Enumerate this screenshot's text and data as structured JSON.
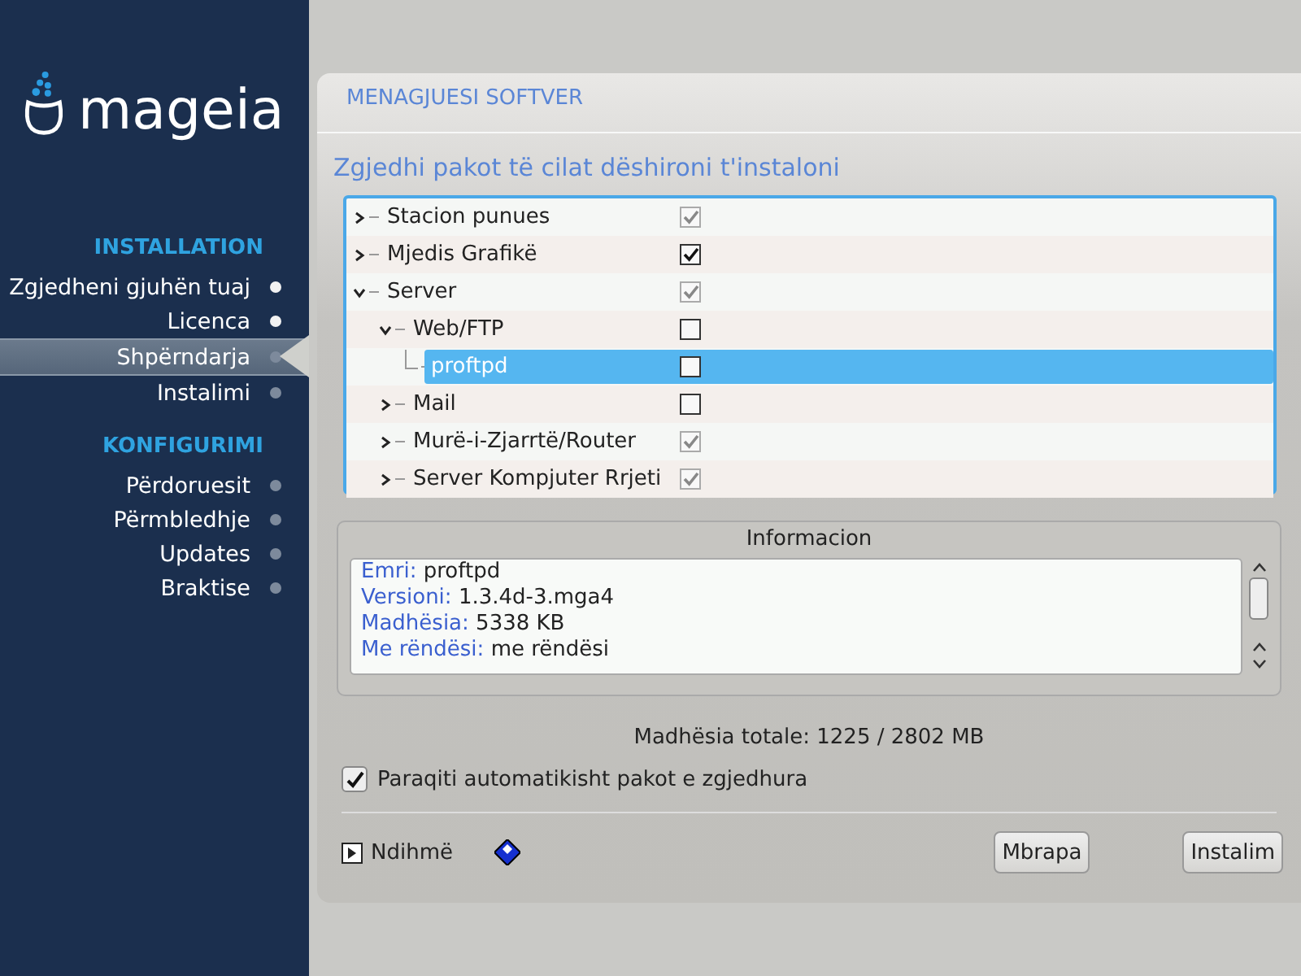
{
  "sidebar": {
    "logo": "mageia",
    "sections": [
      {
        "title": "INSTALLATION",
        "items": [
          {
            "label": "Zgjedheni gjuhën tuaj",
            "done": true,
            "selected": false
          },
          {
            "label": "Licenca",
            "done": true,
            "selected": false
          },
          {
            "label": "Shpërndarja",
            "done": false,
            "selected": true
          },
          {
            "label": "Instalimi",
            "done": false,
            "selected": false
          }
        ]
      },
      {
        "title": "KONFIGURIMI",
        "items": [
          {
            "label": "Përdoruesit",
            "done": false,
            "selected": false
          },
          {
            "label": "Përmbledhje",
            "done": false,
            "selected": false
          },
          {
            "label": "Updates",
            "done": false,
            "selected": false
          },
          {
            "label": "Braktise",
            "done": false,
            "selected": false
          }
        ]
      }
    ]
  },
  "panel": {
    "title": "MENAGJUESI SOFTVER",
    "subtitle": "Zgjedhi pakot të cilat dëshironi t'instaloni",
    "tree": [
      {
        "label": "Stacion punues",
        "checked": true,
        "dimmed": true,
        "expanded": false,
        "selected": false
      },
      {
        "label": "Mjedis Grafikë",
        "checked": true,
        "dimmed": false,
        "expanded": false,
        "selected": false
      },
      {
        "label": "Server",
        "checked": true,
        "dimmed": true,
        "expanded": true,
        "selected": false,
        "children": [
          {
            "label": "Web/FTP",
            "checked": false,
            "dimmed": false,
            "expanded": true,
            "selected": false,
            "children": [
              {
                "label": "proftpd",
                "checked": false,
                "dimmed": false,
                "selected": true
              }
            ]
          },
          {
            "label": "Mail",
            "checked": false,
            "dimmed": false,
            "expanded": false,
            "selected": false
          },
          {
            "label": "Murë-i-Zjarrtë/Router",
            "checked": true,
            "dimmed": true,
            "expanded": false,
            "selected": false
          },
          {
            "label": "Server Kompjuter Rrjeti",
            "checked": true,
            "dimmed": true,
            "expanded": false,
            "selected": false
          }
        ]
      }
    ],
    "info": {
      "title": "Informacion",
      "lines": [
        {
          "label": "Emri:",
          "value": "proftpd"
        },
        {
          "label": "Versioni:",
          "value": "1.3.4d-3.mga4"
        },
        {
          "label": "Madhësia:",
          "value": "5338 KB"
        },
        {
          "label": "Me rëndësi:",
          "value": "me rëndësi"
        }
      ]
    },
    "total": "Madhësia totale: 1225 / 2802 MB",
    "auto_select": {
      "label": "Paraqiti automatikisht pakot e zgjedhura",
      "checked": true
    },
    "help": "Ndihmë",
    "buttons": [
      "Mbrapa",
      "Instalim"
    ]
  }
}
